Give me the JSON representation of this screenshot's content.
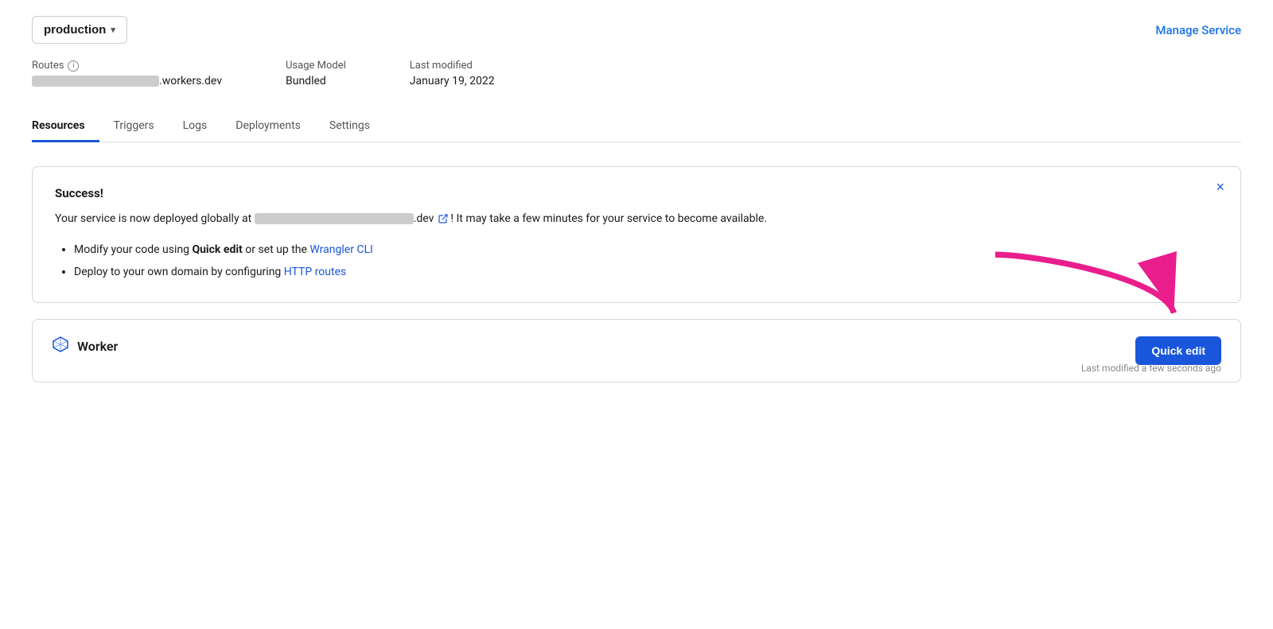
{
  "header": {
    "env_label": "production",
    "chevron": "▾",
    "manage_service_label": "Manage Service"
  },
  "info": {
    "routes_label": "Routes",
    "routes_info_icon": "i",
    "routes_value_blurred": "████████████████████",
    "routes_suffix": ".workers.dev",
    "usage_model_label": "Usage Model",
    "usage_model_value": "Bundled",
    "last_modified_label": "Last modified",
    "last_modified_value": "January 19, 2022"
  },
  "tabs": [
    {
      "id": "resources",
      "label": "Resources",
      "active": true
    },
    {
      "id": "triggers",
      "label": "Triggers",
      "active": false
    },
    {
      "id": "logs",
      "label": "Logs",
      "active": false
    },
    {
      "id": "deployments",
      "label": "Deployments",
      "active": false
    },
    {
      "id": "settings",
      "label": "Settings",
      "active": false
    }
  ],
  "banner": {
    "title": "Success!",
    "body_prefix": "Your service is now deployed globally at ",
    "body_url_blurred": "███████████████████████████",
    "body_url_suffix": ".dev",
    "body_suffix": "! It may take a few minutes for your service to become available.",
    "close_icon": "×",
    "list_items": [
      {
        "text_prefix": "Modify your code using ",
        "bold": "Quick edit",
        "text_mid": " or set up the ",
        "link_text": "Wrangler CLI",
        "link_href": "#"
      },
      {
        "text_prefix": "Deploy to your own domain by configuring ",
        "link_text": "HTTP routes",
        "link_href": "#"
      }
    ]
  },
  "worker_card": {
    "icon": "◇",
    "title": "Worker",
    "quick_edit_label": "Quick edit",
    "last_modified": "Last modified a few seconds ago"
  }
}
